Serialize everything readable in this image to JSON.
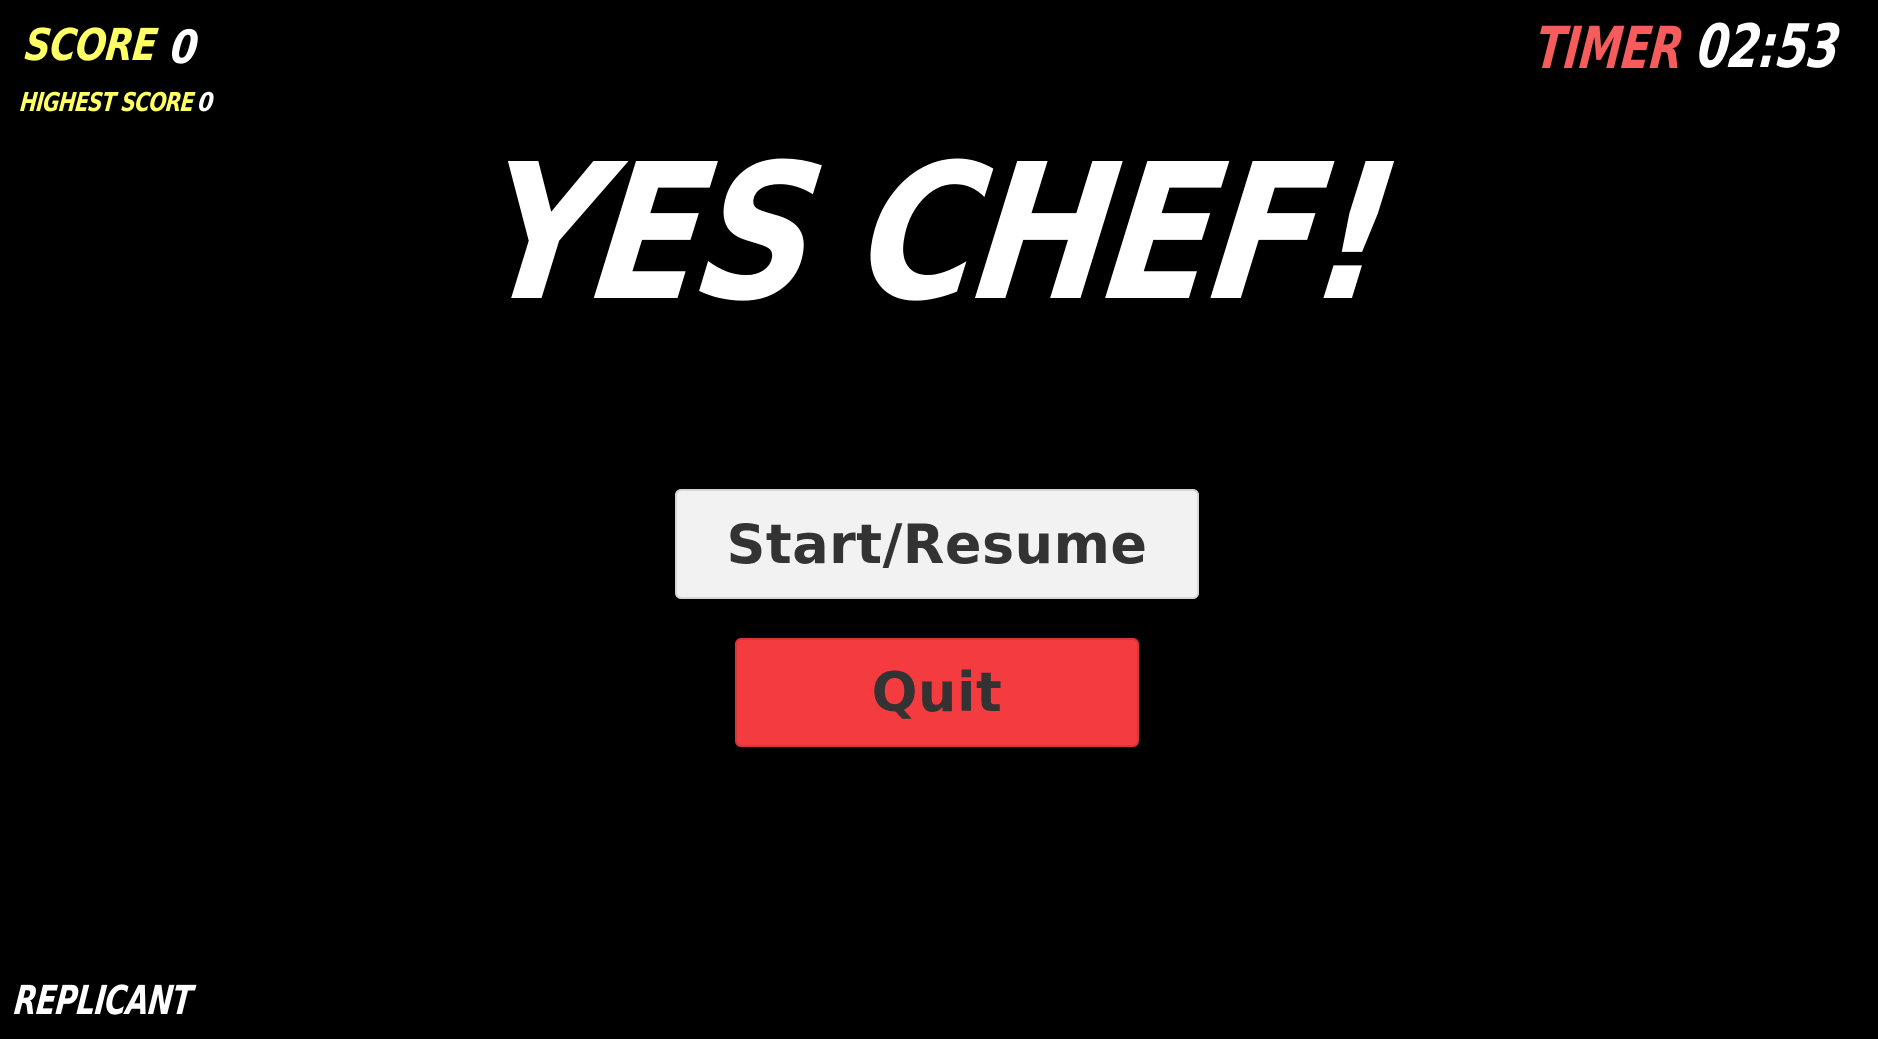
{
  "hud": {
    "score_label": "SCORE",
    "score_value": "0",
    "highest_score_label": "HIGHEST SCORE",
    "highest_score_value": "0",
    "timer_label": "TIMER",
    "timer_value": "02:53"
  },
  "title": "YES CHEF!",
  "menu": {
    "start_label": "Start/Resume",
    "quit_label": "Quit"
  },
  "footer": {
    "label": "REPLICANT"
  },
  "colors": {
    "background": "#000000",
    "score_label": "#ffff66",
    "timer_label": "#f75c5c",
    "start_button": "#f2f2f2",
    "quit_button": "#f43b40",
    "button_text": "#333333"
  }
}
